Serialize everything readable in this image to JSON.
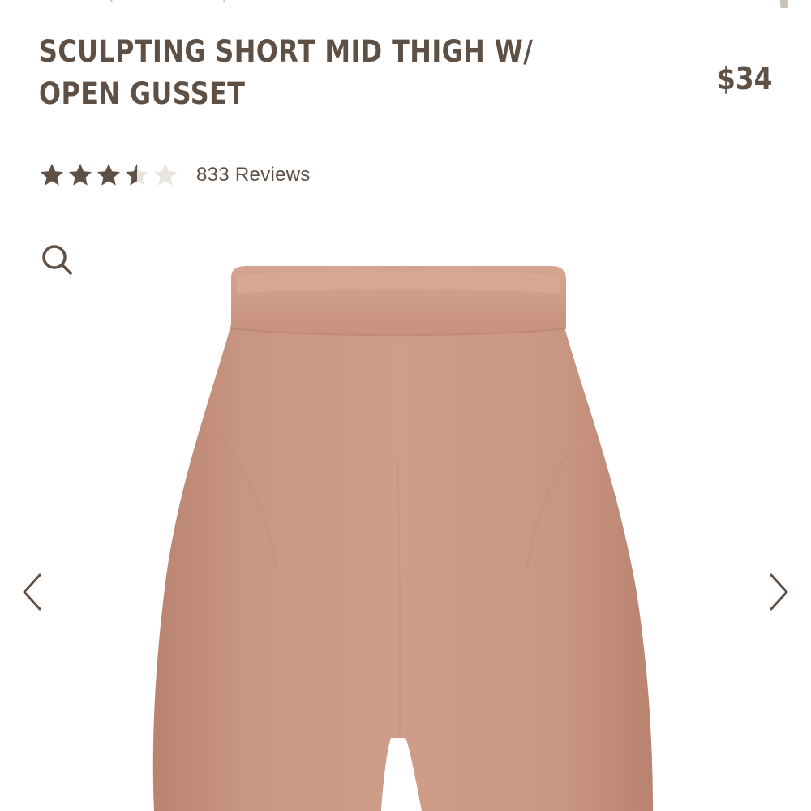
{
  "product": {
    "title": "SCULPTING SHORT MID THIGH W/ OPEN GUSSET",
    "price": "$34",
    "rating": {
      "value": 3.5,
      "max": 5,
      "reviews_label": "833 Reviews"
    }
  },
  "gallery": {
    "product_color": "#c89580"
  },
  "icons": {
    "search": "search-icon",
    "prev": "chevron-left-icon",
    "next": "chevron-right-icon",
    "star": "star-icon"
  },
  "colors": {
    "text": "#5e5045",
    "star_filled": "#5e5045",
    "star_empty": "#e8e4e0"
  }
}
